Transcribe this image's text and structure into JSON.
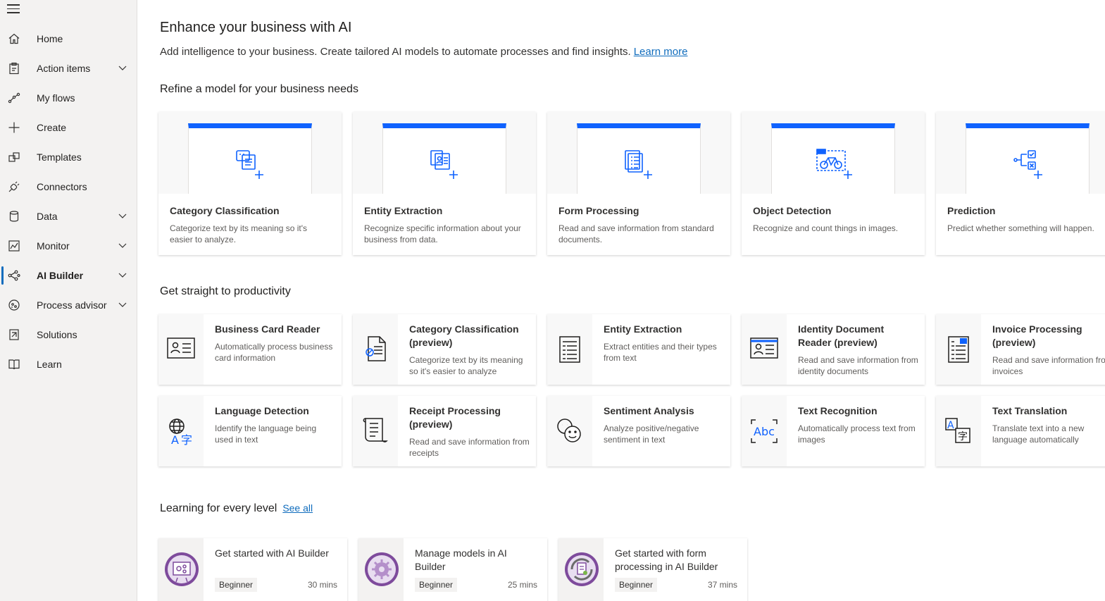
{
  "sidebar": {
    "items": [
      {
        "label": "Home"
      },
      {
        "label": "Action items"
      },
      {
        "label": "My flows"
      },
      {
        "label": "Create"
      },
      {
        "label": "Templates"
      },
      {
        "label": "Connectors"
      },
      {
        "label": "Data"
      },
      {
        "label": "Monitor"
      },
      {
        "label": "AI Builder"
      },
      {
        "label": "Process advisor"
      },
      {
        "label": "Solutions"
      },
      {
        "label": "Learn"
      }
    ]
  },
  "header": {
    "title": "Enhance your business with AI",
    "subtitle": "Add intelligence to your business. Create tailored AI models to automate processes and find insights.",
    "learn_more": "Learn more"
  },
  "sections": {
    "refine": "Refine a model for your business needs",
    "productivity": "Get straight to productivity",
    "learning": "Learning for every level",
    "see_all": "See all"
  },
  "models": [
    {
      "title": "Category Classification",
      "desc": "Categorize text by its meaning so it's easier to analyze."
    },
    {
      "title": "Entity Extraction",
      "desc": "Recognize specific information about your business from data."
    },
    {
      "title": "Form Processing",
      "desc": "Read and save information from standard documents."
    },
    {
      "title": "Object Detection",
      "desc": "Recognize and count things in images."
    },
    {
      "title": "Prediction",
      "desc": "Predict whether something will happen."
    }
  ],
  "prebuilt": [
    {
      "title": "Business Card Reader",
      "desc": "Automatically process business card information"
    },
    {
      "title": "Category Classification (preview)",
      "desc": "Categorize text by its meaning so it's easier to analyze"
    },
    {
      "title": "Entity Extraction",
      "desc": "Extract entities and their types from text"
    },
    {
      "title": "Identity Document Reader (preview)",
      "desc": "Read and save information from identity documents"
    },
    {
      "title": "Invoice Processing (preview)",
      "desc": "Read and save information from invoices"
    },
    {
      "title": "Language Detection",
      "desc": "Identify the language being used in text"
    },
    {
      "title": "Receipt Processing (preview)",
      "desc": "Read and save information from receipts"
    },
    {
      "title": "Sentiment Analysis",
      "desc": "Analyze positive/negative sentiment in text"
    },
    {
      "title": "Text Recognition",
      "desc": "Automatically process text from images"
    },
    {
      "title": "Text Translation",
      "desc": "Translate text into a new language automatically"
    }
  ],
  "learning": [
    {
      "title": "Get started with AI Builder",
      "level": "Beginner",
      "duration": "30 mins"
    },
    {
      "title": "Manage models in AI Builder",
      "level": "Beginner",
      "duration": "25 mins"
    },
    {
      "title": "Get started with form processing in AI Builder",
      "level": "Beginner",
      "duration": "37 mins"
    }
  ],
  "colors": {
    "accent": "#0f62fe",
    "link": "#0f6cbd",
    "sidebar_bg": "#f3f2f1",
    "badge_purple": "#7e4b9c"
  }
}
